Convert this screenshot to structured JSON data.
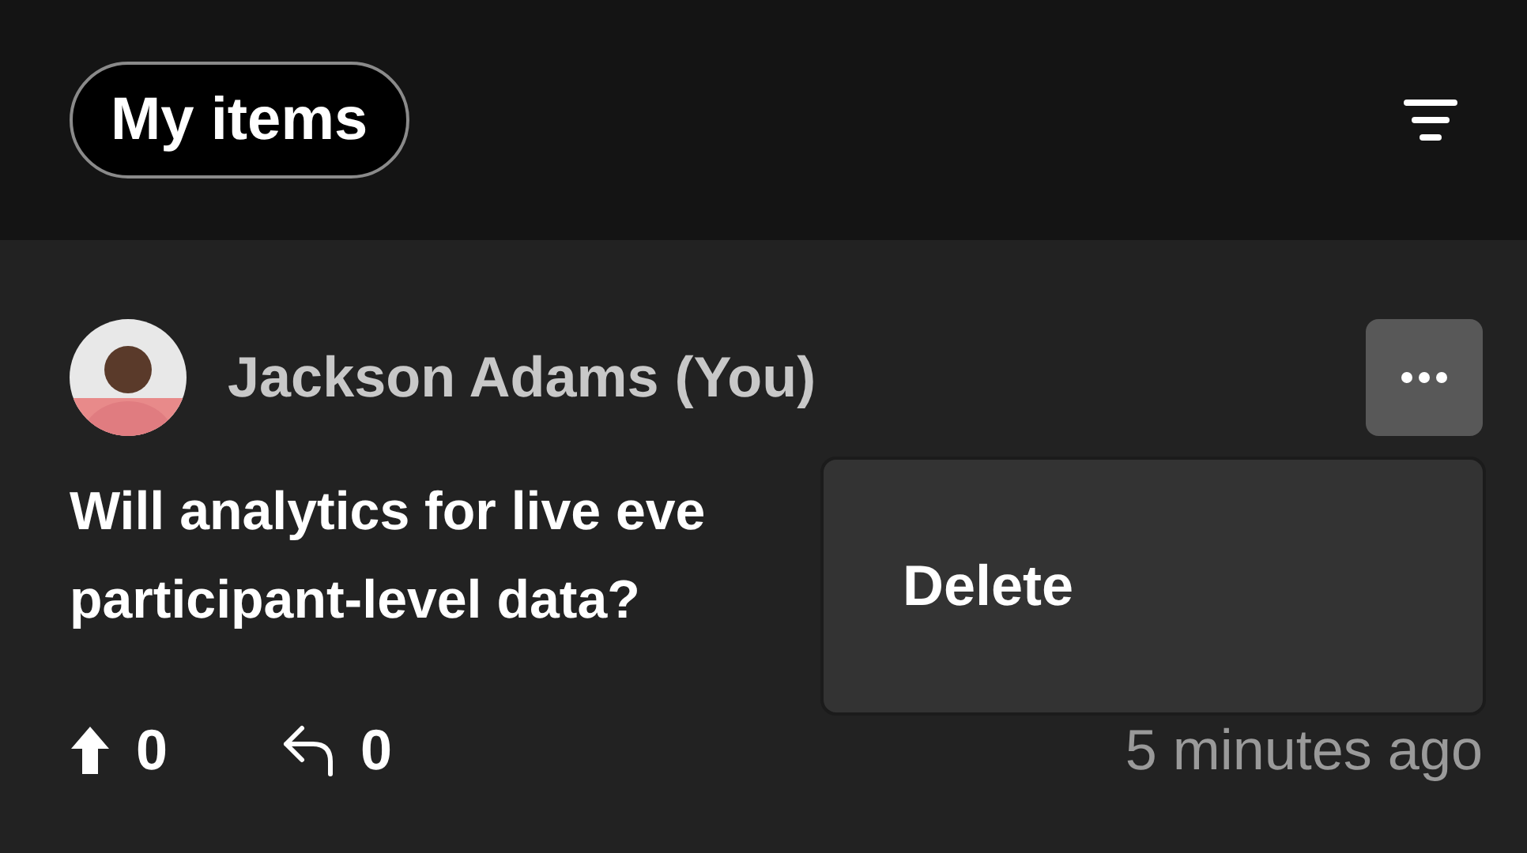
{
  "header": {
    "title": "My items"
  },
  "post": {
    "author": "Jackson Adams (You)",
    "question_lines": [
      "Will analytics for live eve",
      "participant-level data?"
    ],
    "upvotes": "0",
    "replies": "0",
    "time": "5 minutes ago",
    "menu_open": true
  },
  "menu": {
    "items": [
      "Delete"
    ]
  }
}
